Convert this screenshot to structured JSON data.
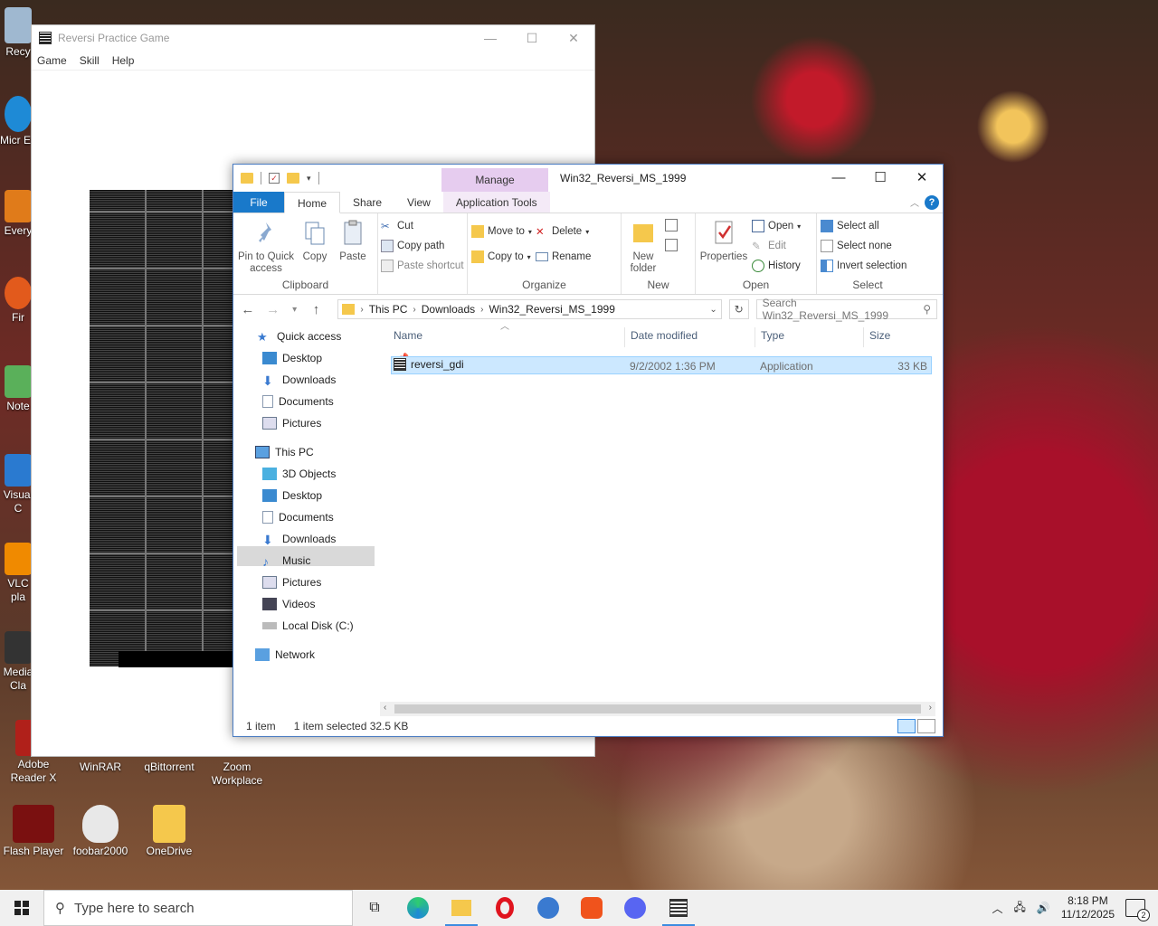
{
  "desktop": {
    "icons": [
      {
        "label": "Recy",
        "color": "#9fb8d0"
      },
      {
        "label": "Micr Ec",
        "color": "#1e8ad6"
      },
      {
        "label": "Every",
        "color": "#e07b1a"
      },
      {
        "label": "Fir",
        "color": "#e25a1c"
      },
      {
        "label": "Note",
        "color": "#5ab05a"
      },
      {
        "label": "Visual C",
        "color": "#2a7ad0"
      },
      {
        "label": "VLC pla",
        "color": "#f08a00"
      },
      {
        "label": "Media Cla",
        "color": "#333333"
      },
      {
        "label": "Adobe Reader X",
        "color": "#b0201a"
      },
      {
        "label": "WinRAR",
        "color": "#8a3a9a"
      },
      {
        "label": "qBittorrent",
        "color": "#3a7ad0"
      },
      {
        "label": "Zoom Workplace",
        "color": "#2d8cff"
      },
      {
        "label": "Flash Player",
        "color": "#7a1010"
      },
      {
        "label": "foobar2000",
        "color": "#e8e8e8"
      },
      {
        "label": "OneDrive",
        "color": "#f5c84c"
      }
    ]
  },
  "reversi": {
    "title": "Reversi Practice Game",
    "menu": [
      "Game",
      "Skill",
      "Help"
    ],
    "controls": [
      "—",
      "☐",
      "✕"
    ]
  },
  "explorer": {
    "title": "Win32_Reversi_MS_1999",
    "manage": "Manage",
    "tabs": [
      "File",
      "Home",
      "Share",
      "View",
      "Application Tools"
    ],
    "help": "?",
    "controls": [
      "—",
      "☐",
      "✕"
    ],
    "ribbon": {
      "clipboard": {
        "label": "Clipboard",
        "pin": "Pin to Quick access",
        "copy": "Copy",
        "paste": "Paste",
        "cut": "Cut",
        "copy_path": "Copy path",
        "paste_shortcut": "Paste shortcut"
      },
      "organize": {
        "label": "Organize",
        "move_to": "Move to",
        "copy_to": "Copy to",
        "delete": "Delete",
        "rename": "Rename"
      },
      "new": {
        "label": "New",
        "new_folder": "New folder"
      },
      "open": {
        "label": "Open",
        "properties": "Properties",
        "open": "Open",
        "edit": "Edit",
        "history": "History"
      },
      "select": {
        "label": "Select",
        "select_all": "Select all",
        "select_none": "Select none",
        "invert": "Invert selection"
      }
    },
    "address": {
      "crumbs": [
        "This PC",
        "Downloads",
        "Win32_Reversi_MS_1999"
      ],
      "search_placeholder": "Search Win32_Reversi_MS_1999"
    },
    "nav": {
      "quick_access": "Quick access",
      "quick": [
        "Desktop",
        "Downloads",
        "Documents",
        "Pictures"
      ],
      "this_pc": "This PC",
      "pc": [
        "3D Objects",
        "Desktop",
        "Documents",
        "Downloads",
        "Music",
        "Pictures",
        "Videos",
        "Local Disk (C:)"
      ],
      "network": "Network"
    },
    "columns": {
      "name": "Name",
      "date": "Date modified",
      "type": "Type",
      "size": "Size"
    },
    "files": [
      {
        "name": "reversi_gdi",
        "date": "9/2/2002 1:36 PM",
        "type": "Application",
        "size": "33 KB"
      }
    ],
    "status": {
      "items": "1 item",
      "selected": "1 item selected  32.5 KB"
    }
  },
  "taskbar": {
    "search_placeholder": "Type here to search",
    "time": "8:18 PM",
    "date": "11/12/2025",
    "notifications": "2"
  }
}
